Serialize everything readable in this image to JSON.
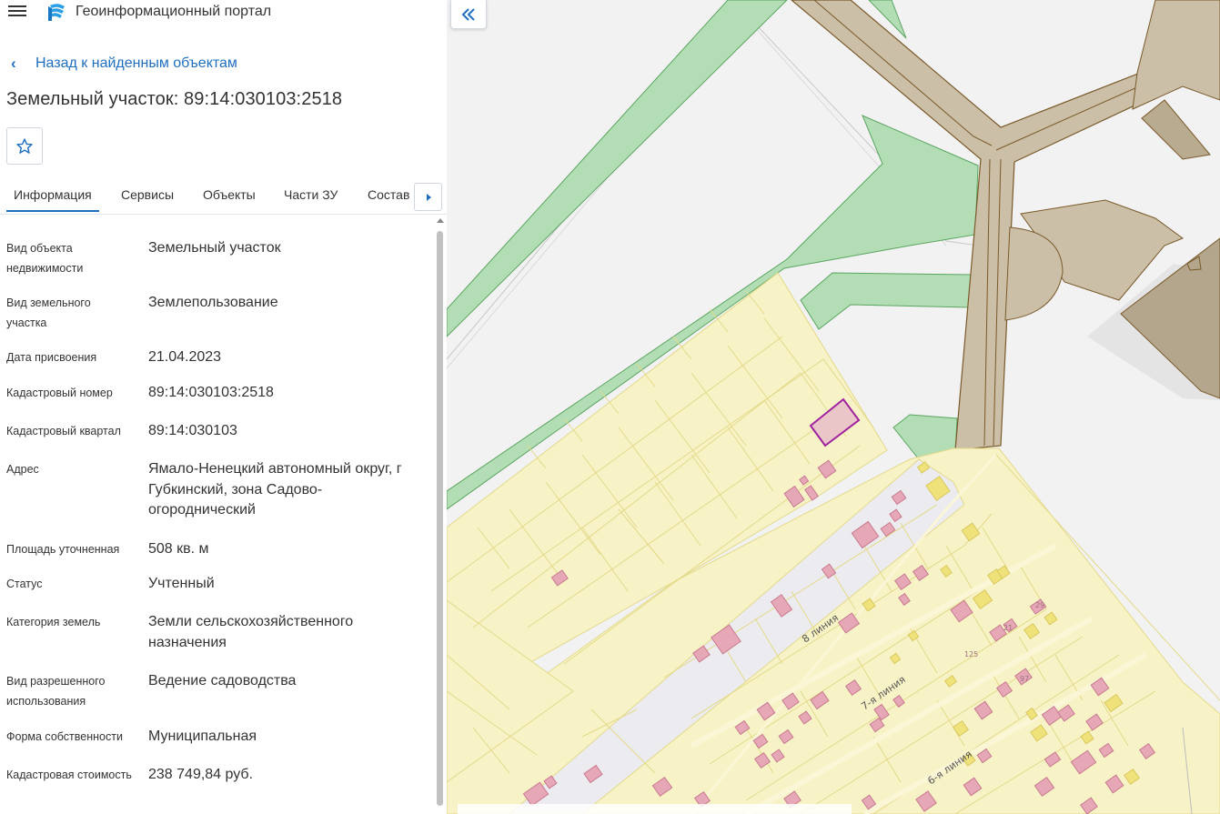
{
  "header": {
    "app_title": "Геоинформационный портал",
    "logo_icon": "portal-logo-icon",
    "menu_icon": "hamburger-menu-icon"
  },
  "nav": {
    "back_label": "Назад к найденным объектам"
  },
  "object": {
    "title": "Земельный участок: 89:14:030103:2518"
  },
  "tabs": [
    {
      "label": "Информация",
      "active": true
    },
    {
      "label": "Сервисы",
      "active": false
    },
    {
      "label": "Объекты",
      "active": false
    },
    {
      "label": "Части ЗУ",
      "active": false
    },
    {
      "label": "Состав",
      "active": false
    }
  ],
  "properties": [
    {
      "key": "Вид объекта недвижимости",
      "value": "Земельный участок"
    },
    {
      "key": "Вид земельного участка",
      "value": "Землепользование"
    },
    {
      "key": "Дата присвоения",
      "value": "21.04.2023"
    },
    {
      "key": "Кадастровый номер",
      "value": "89:14:030103:2518"
    },
    {
      "key": "Кадастровый квартал",
      "value": "89:14:030103"
    },
    {
      "key": "Адрес",
      "value": "Ямало-Ненецкий автономный округ, г Губкинский, зона Садово-огороднический"
    },
    {
      "key": "Площадь уточненная",
      "value": "508 кв. м"
    },
    {
      "key": "Статус",
      "value": "Учтенный"
    },
    {
      "key": "Категория земель",
      "value": "Земли сельскохозяйственного назначения"
    },
    {
      "key": "Вид разрешенного использования",
      "value": "Ведение садоводства"
    },
    {
      "key": "Форма собственности",
      "value": "Муниципальная"
    },
    {
      "key": "Кадастровая стоимость",
      "value": "238 749,84 руб."
    }
  ],
  "map": {
    "streets": [
      "8 линия",
      "7-я линия",
      "6-я линия"
    ],
    "parcel_numbers": [
      "29",
      "21",
      "125",
      "97"
    ],
    "colors": {
      "background": "#f2f2f2",
      "garden_zone": "#f8f3c6",
      "garden_stroke": "#e3d98a",
      "green_zone": "#b3ddb4",
      "green_stroke": "#5aa560",
      "road": "#cbbfa7",
      "road_stroke": "#7a5a2a",
      "building": "#e6a8b6",
      "building_stroke": "#c97a90",
      "selected_stroke": "#a021a0"
    }
  },
  "icons": {
    "favorite": "star-outline-icon",
    "tabs_next": "caret-right-icon",
    "collapse": "double-chevron-left-icon",
    "back": "chevron-left-icon"
  }
}
